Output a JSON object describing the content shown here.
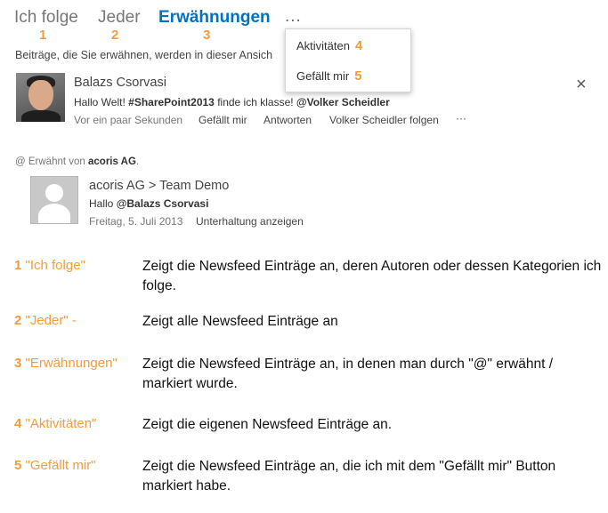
{
  "tabs": [
    {
      "label": "Ich folge",
      "number": "1"
    },
    {
      "label": "Jeder",
      "number": "2"
    },
    {
      "label": "Erwähnungen",
      "number": "3"
    }
  ],
  "more_label": "...",
  "description": "Beiträge, die Sie erwähnen, werden in dieser Ansich",
  "dropdown": [
    {
      "label": "Aktivitäten",
      "number": "4"
    },
    {
      "label": "Gefällt mir",
      "number": "5"
    }
  ],
  "post": {
    "author": "Balazs Csorvasi",
    "text_prefix": "Hallo Welt! ",
    "hashtag": "#SharePoint2013",
    "text_middle": " finde ich klasse! ",
    "mention": "@Volker Scheidler",
    "time": "Vor ein paar Sekunden",
    "actions": [
      "Gefällt mir",
      "Antworten",
      "Volker Scheidler folgen",
      "···"
    ],
    "close_label": "×"
  },
  "mentioned": {
    "prefix": "@ Erwähnt von ",
    "by": "acoris AG",
    "suffix": ".",
    "title": "acoris AG > Team Demo",
    "text_prefix": "Hallo ",
    "text_mention": "@Balazs Csorvasi",
    "date": "Freitag, 5. Juli 2013",
    "action": "Unterhaltung anzeigen"
  },
  "legend": [
    {
      "num": "1",
      "key": "\"Ich folge\"",
      "text": "Zeigt die Newsfeed Einträge an, deren Autoren oder dessen Kategorien ich folge."
    },
    {
      "num": "2",
      "key": "\"Jeder\" -",
      "text": "Zeigt alle Newsfeed Einträge an"
    },
    {
      "num": "3",
      "key": "\"Erwähnungen\"",
      "text": "Zeigt die Newsfeed Einträge an, in denen man durch \"@\" erwähnt / markiert wurde."
    },
    {
      "num": "4",
      "key": "\"Aktivitäten\"",
      "text": "Zeigt die eigenen Newsfeed Einträge an."
    },
    {
      "num": "5",
      "key": "\"Gefällt mir\"",
      "text": "Zeigt die Newsfeed Einträge an, die ich mit dem \"Gefällt mir\" Button markiert habe."
    }
  ],
  "colors": {
    "accent": "#0072c6",
    "number_orange": "#f39c3c"
  }
}
